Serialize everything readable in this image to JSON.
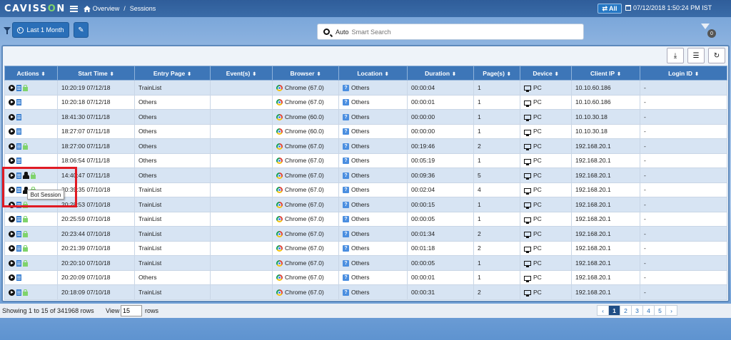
{
  "header": {
    "logo_main": "CAVISS",
    "logo_o": "O",
    "logo_end": "N",
    "breadcrumb_overview": "Overview",
    "breadcrumb_sep": "/",
    "breadcrumb_sessions": "Sessions",
    "all_label": "All",
    "datetime": "07/12/2018 1:50:24 PM IST"
  },
  "toolbar": {
    "period_label": "Last 1 Month",
    "search_prefix": "Auto",
    "search_placeholder": "Smart Search",
    "filter_count": "0"
  },
  "table": {
    "columns": [
      "Actions",
      "Start Time",
      "Entry Page",
      "Event(s)",
      "Browser",
      "Location",
      "Duration",
      "Page(s)",
      "Device",
      "Client IP",
      "Login ID"
    ],
    "rows": [
      {
        "start": "10:20:19 07/12/18",
        "entry": "TrainList",
        "events": "",
        "browser": "Chrome (67.0)",
        "location": "Others",
        "duration": "00:00:04",
        "pages": "1",
        "device": "PC",
        "ip": "10.10.60.186",
        "login": "-",
        "lock": true,
        "bot": false
      },
      {
        "start": "10:20:18 07/12/18",
        "entry": "Others",
        "events": "",
        "browser": "Chrome (67.0)",
        "location": "Others",
        "duration": "00:00:01",
        "pages": "1",
        "device": "PC",
        "ip": "10.10.60.186",
        "login": "-",
        "lock": false,
        "bot": false
      },
      {
        "start": "18:41:30 07/11/18",
        "entry": "Others",
        "events": "",
        "browser": "Chrome (60.0)",
        "location": "Others",
        "duration": "00:00:00",
        "pages": "1",
        "device": "PC",
        "ip": "10.10.30.18",
        "login": "-",
        "lock": false,
        "bot": false
      },
      {
        "start": "18:27:07 07/11/18",
        "entry": "Others",
        "events": "",
        "browser": "Chrome (60.0)",
        "location": "Others",
        "duration": "00:00:00",
        "pages": "1",
        "device": "PC",
        "ip": "10.10.30.18",
        "login": "-",
        "lock": false,
        "bot": false
      },
      {
        "start": "18:27:00 07/11/18",
        "entry": "Others",
        "events": "",
        "browser": "Chrome (67.0)",
        "location": "Others",
        "duration": "00:19:46",
        "pages": "2",
        "device": "PC",
        "ip": "192.168.20.1",
        "login": "-",
        "lock": true,
        "bot": false
      },
      {
        "start": "18:06:54 07/11/18",
        "entry": "Others",
        "events": "",
        "browser": "Chrome (67.0)",
        "location": "Others",
        "duration": "00:05:19",
        "pages": "1",
        "device": "PC",
        "ip": "192.168.20.1",
        "login": "-",
        "lock": false,
        "bot": false
      },
      {
        "start": "14:40:47 07/11/18",
        "entry": "Others",
        "events": "",
        "browser": "Chrome (67.0)",
        "location": "Others",
        "duration": "00:09:36",
        "pages": "5",
        "device": "PC",
        "ip": "192.168.20.1",
        "login": "-",
        "lock": true,
        "bot": true
      },
      {
        "start": "20:39:35 07/10/18",
        "entry": "TrainList",
        "events": "",
        "browser": "Chrome (67.0)",
        "location": "Others",
        "duration": "00:02:04",
        "pages": "4",
        "device": "PC",
        "ip": "192.168.20.1",
        "login": "-",
        "lock": true,
        "bot": true
      },
      {
        "start": "20:28:53 07/10/18",
        "entry": "TrainList",
        "events": "",
        "browser": "Chrome (67.0)",
        "location": "Others",
        "duration": "00:00:15",
        "pages": "1",
        "device": "PC",
        "ip": "192.168.20.1",
        "login": "-",
        "lock": true,
        "bot": false
      },
      {
        "start": "20:25:59 07/10/18",
        "entry": "TrainList",
        "events": "",
        "browser": "Chrome (67.0)",
        "location": "Others",
        "duration": "00:00:05",
        "pages": "1",
        "device": "PC",
        "ip": "192.168.20.1",
        "login": "-",
        "lock": true,
        "bot": false
      },
      {
        "start": "20:23:44 07/10/18",
        "entry": "TrainList",
        "events": "",
        "browser": "Chrome (67.0)",
        "location": "Others",
        "duration": "00:01:34",
        "pages": "2",
        "device": "PC",
        "ip": "192.168.20.1",
        "login": "-",
        "lock": true,
        "bot": false
      },
      {
        "start": "20:21:39 07/10/18",
        "entry": "TrainList",
        "events": "",
        "browser": "Chrome (67.0)",
        "location": "Others",
        "duration": "00:01:18",
        "pages": "2",
        "device": "PC",
        "ip": "192.168.20.1",
        "login": "-",
        "lock": true,
        "bot": false
      },
      {
        "start": "20:20:10 07/10/18",
        "entry": "TrainList",
        "events": "",
        "browser": "Chrome (67.0)",
        "location": "Others",
        "duration": "00:00:05",
        "pages": "1",
        "device": "PC",
        "ip": "192.168.20.1",
        "login": "-",
        "lock": true,
        "bot": false
      },
      {
        "start": "20:20:09 07/10/18",
        "entry": "Others",
        "events": "",
        "browser": "Chrome (67.0)",
        "location": "Others",
        "duration": "00:00:01",
        "pages": "1",
        "device": "PC",
        "ip": "192.168.20.1",
        "login": "-",
        "lock": false,
        "bot": false
      },
      {
        "start": "20:18:09 07/10/18",
        "entry": "TrainList",
        "events": "",
        "browser": "Chrome (67.0)",
        "location": "Others",
        "duration": "00:00:31",
        "pages": "2",
        "device": "PC",
        "ip": "192.168.20.1",
        "login": "-",
        "lock": true,
        "bot": false
      }
    ]
  },
  "tooltip": "Bot Session",
  "footer": {
    "showing": "Showing 1 to 15 of 341968 rows",
    "view_label": "View",
    "view_value": "15",
    "rows_label": "rows",
    "pages": [
      "1",
      "2",
      "3",
      "4",
      "5"
    ],
    "prev": "‹",
    "next": "›"
  },
  "colors": {
    "header_bg": "#3d76b8",
    "accent": "#2a6fb8",
    "highlight": "#e01b24",
    "lock": "#7fd36b"
  }
}
